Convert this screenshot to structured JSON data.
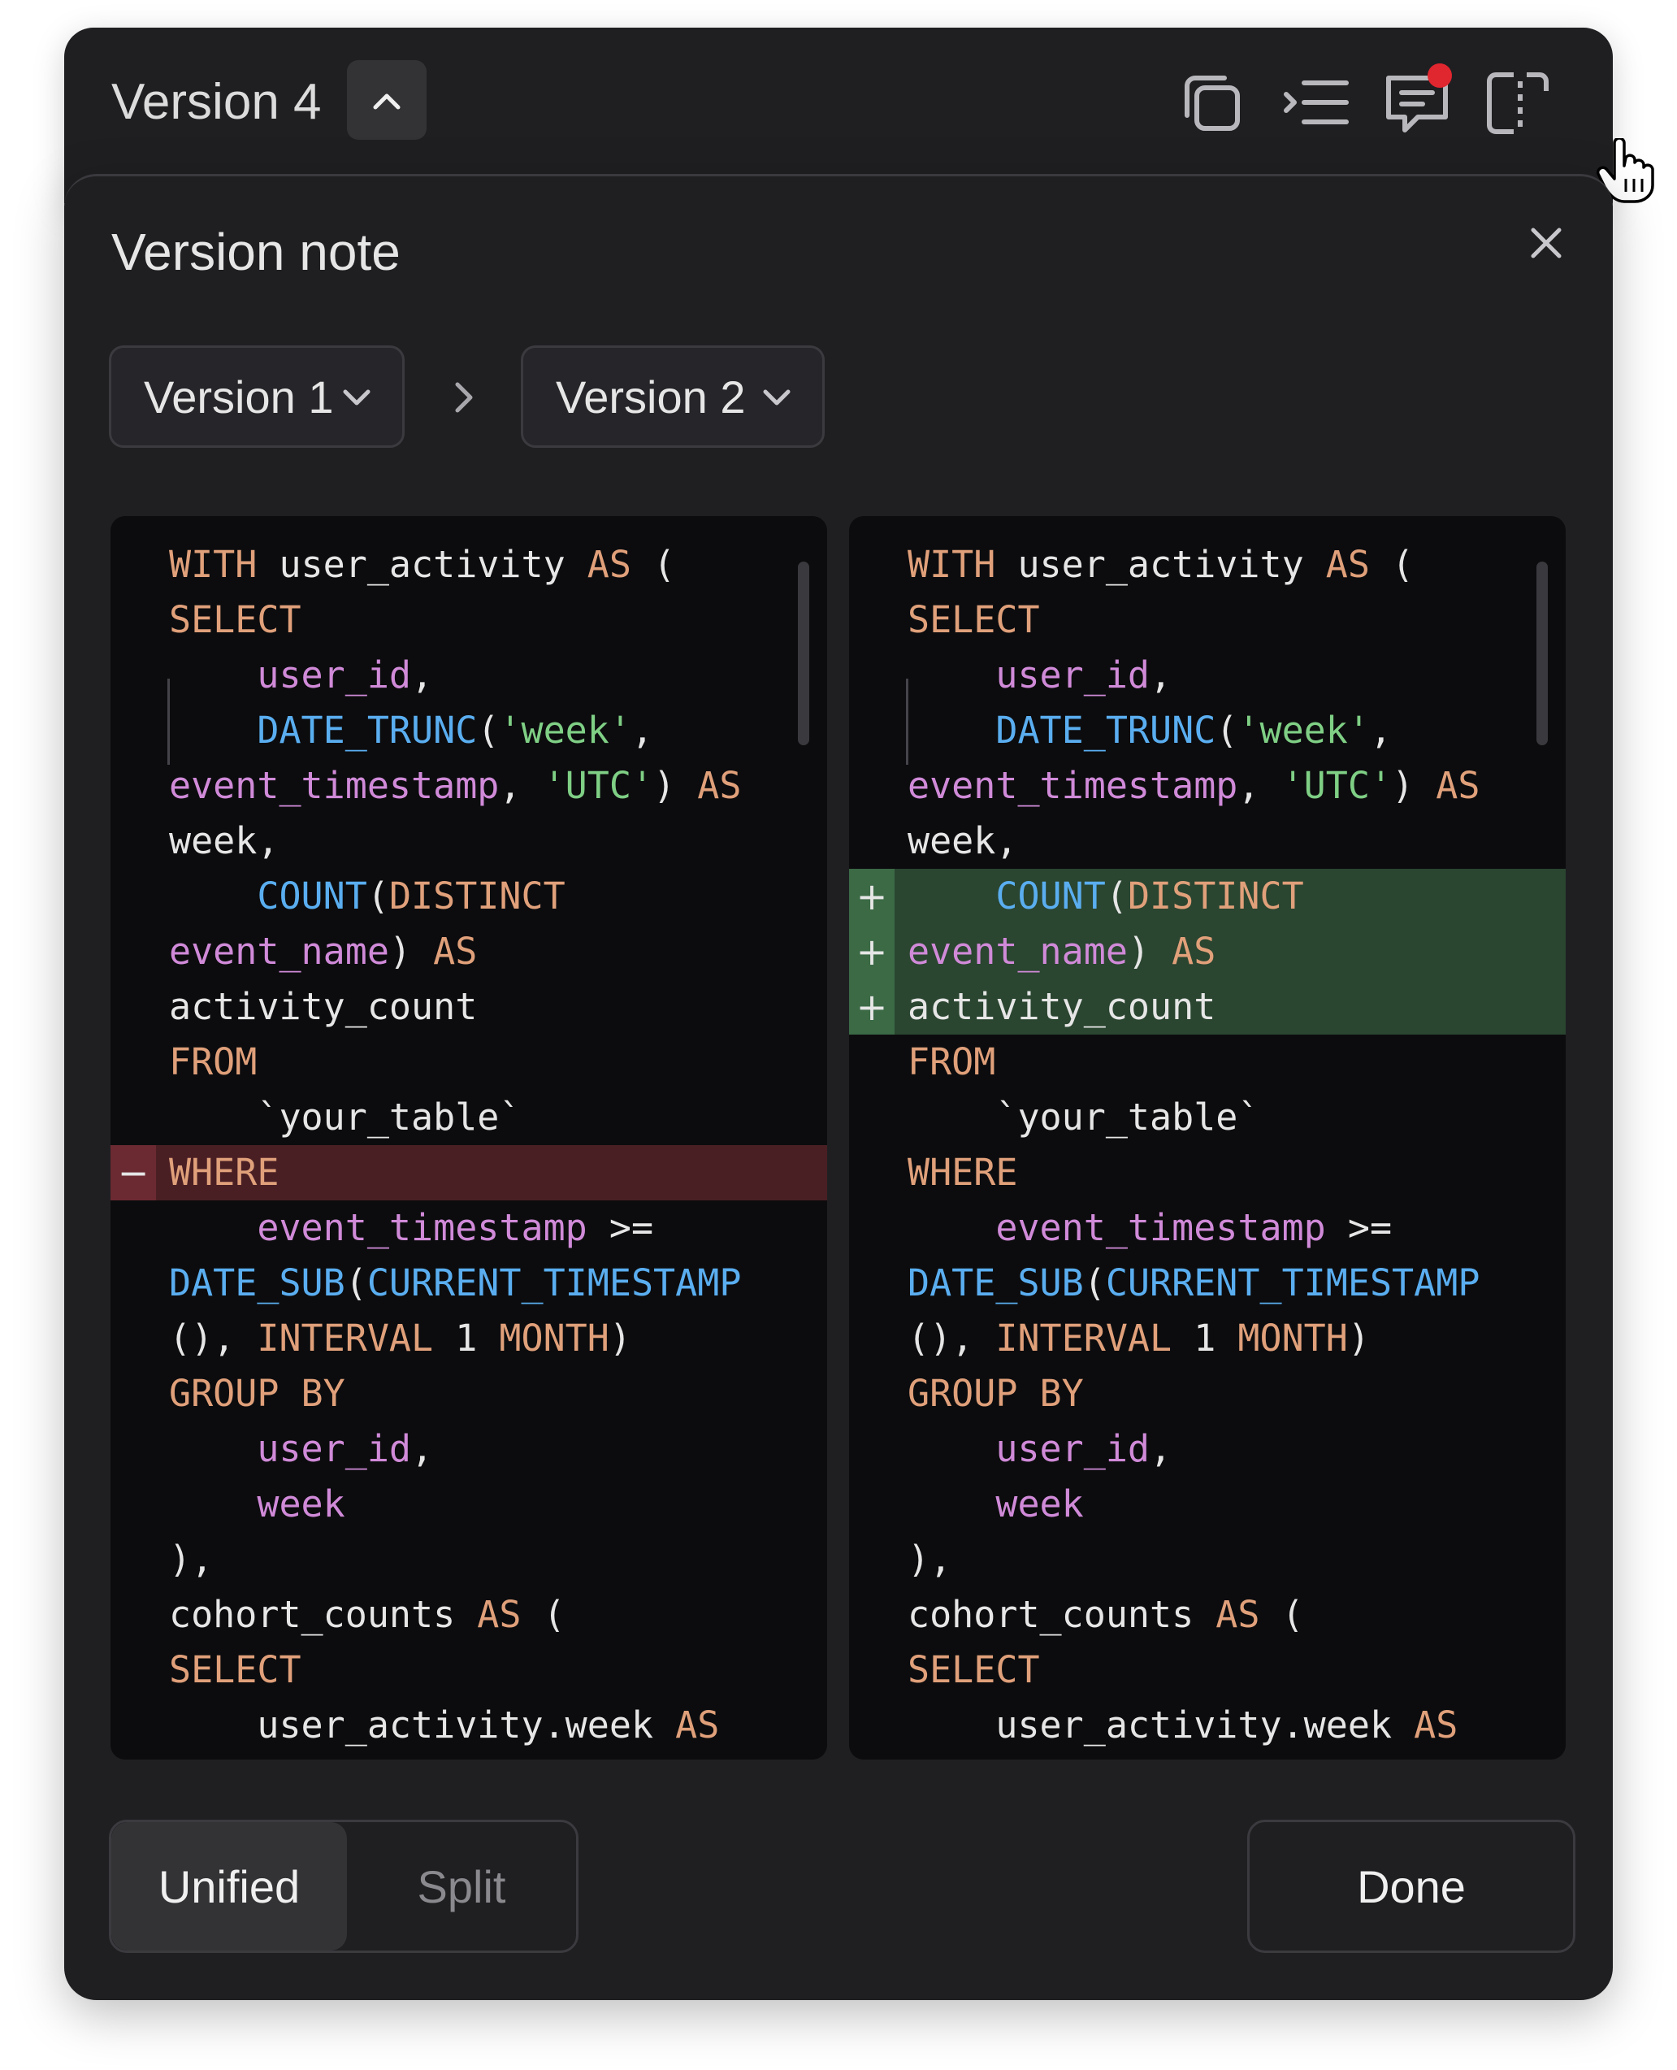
{
  "header": {
    "title": "Version 4",
    "toolbar_icons": [
      "copy-icon",
      "outline-icon",
      "comment-icon",
      "select-icon"
    ],
    "has_notification": true
  },
  "dialog": {
    "title": "Version note",
    "from_version": "Version 1",
    "to_version": "Version 2",
    "view_modes": [
      "Unified",
      "Split"
    ],
    "selected_view_mode": "Unified",
    "done_label": "Done"
  },
  "colors": {
    "keyword": "#e0a07a",
    "function": "#5aaef0",
    "identifier": "#d08ad8",
    "string": "#7fcf85",
    "added_bg": "#2a4530",
    "removed_bg": "#4a1f24",
    "notification": "#e0262f"
  },
  "left_code": [
    {
      "diff": "",
      "tokens": [
        [
          "kw",
          "WITH"
        ],
        [
          "pl",
          " user_activity "
        ],
        [
          "kw",
          "AS"
        ],
        [
          "pl",
          " ("
        ]
      ]
    },
    {
      "diff": "",
      "tokens": [
        [
          "kw",
          "SELECT"
        ]
      ]
    },
    {
      "diff": "",
      "tokens": [
        [
          "pl",
          "    "
        ],
        [
          "id",
          "user_id"
        ],
        [
          "pl",
          ","
        ]
      ]
    },
    {
      "diff": "",
      "tokens": [
        [
          "pl",
          "    "
        ],
        [
          "fn",
          "DATE_TRUNC"
        ],
        [
          "pl",
          "("
        ],
        [
          "str",
          "'week'"
        ],
        [
          "pl",
          ","
        ]
      ]
    },
    {
      "diff": "",
      "tokens": [
        [
          "id",
          "event_timestamp"
        ],
        [
          "pl",
          ", "
        ],
        [
          "str",
          "'UTC'"
        ],
        [
          "pl",
          ") "
        ],
        [
          "kw",
          "AS"
        ]
      ]
    },
    {
      "diff": "",
      "tokens": [
        [
          "pl",
          "week,"
        ]
      ]
    },
    {
      "diff": "",
      "tokens": [
        [
          "pl",
          "    "
        ],
        [
          "fn",
          "COUNT"
        ],
        [
          "pl",
          "("
        ],
        [
          "kw",
          "DISTINCT"
        ]
      ]
    },
    {
      "diff": "",
      "tokens": [
        [
          "id",
          "event_name"
        ],
        [
          "pl",
          ") "
        ],
        [
          "kw",
          "AS"
        ]
      ]
    },
    {
      "diff": "",
      "tokens": [
        [
          "pl",
          "activity_count"
        ]
      ]
    },
    {
      "diff": "",
      "tokens": [
        [
          "kw",
          "FROM"
        ]
      ]
    },
    {
      "diff": "",
      "tokens": [
        [
          "pl",
          "    `your_table`"
        ]
      ]
    },
    {
      "diff": "removed",
      "mark": "−",
      "tokens": [
        [
          "kw",
          "WHERE"
        ]
      ]
    },
    {
      "diff": "",
      "tokens": [
        [
          "pl",
          "    "
        ],
        [
          "id",
          "event_timestamp"
        ],
        [
          "pl",
          " >="
        ]
      ]
    },
    {
      "diff": "",
      "tokens": [
        [
          "fn",
          "DATE_SUB"
        ],
        [
          "pl",
          "("
        ],
        [
          "fn",
          "CURRENT_TIMESTAMP"
        ]
      ]
    },
    {
      "diff": "",
      "tokens": [
        [
          "pl",
          "(), "
        ],
        [
          "kw",
          "INTERVAL"
        ],
        [
          "pl",
          " 1 "
        ],
        [
          "kw",
          "MONTH"
        ],
        [
          "pl",
          ")"
        ]
      ]
    },
    {
      "diff": "",
      "tokens": [
        [
          "kw",
          "GROUP BY"
        ]
      ]
    },
    {
      "diff": "",
      "tokens": [
        [
          "pl",
          "    "
        ],
        [
          "id",
          "user_id"
        ],
        [
          "pl",
          ","
        ]
      ]
    },
    {
      "diff": "",
      "tokens": [
        [
          "pl",
          "    "
        ],
        [
          "id",
          "week"
        ]
      ]
    },
    {
      "diff": "",
      "tokens": [
        [
          "pl",
          "),"
        ]
      ]
    },
    {
      "diff": "",
      "tokens": [
        [
          "pl",
          "cohort_counts "
        ],
        [
          "kw",
          "AS"
        ],
        [
          "pl",
          " ("
        ]
      ]
    },
    {
      "diff": "",
      "tokens": [
        [
          "kw",
          "SELECT"
        ]
      ]
    },
    {
      "diff": "",
      "tokens": [
        [
          "pl",
          "    user_activity.week "
        ],
        [
          "kw",
          "AS"
        ]
      ]
    }
  ],
  "right_code": [
    {
      "diff": "",
      "tokens": [
        [
          "kw",
          "WITH"
        ],
        [
          "pl",
          " user_activity "
        ],
        [
          "kw",
          "AS"
        ],
        [
          "pl",
          " ("
        ]
      ]
    },
    {
      "diff": "",
      "tokens": [
        [
          "kw",
          "SELECT"
        ]
      ]
    },
    {
      "diff": "",
      "tokens": [
        [
          "pl",
          "    "
        ],
        [
          "id",
          "user_id"
        ],
        [
          "pl",
          ","
        ]
      ]
    },
    {
      "diff": "",
      "tokens": [
        [
          "pl",
          "    "
        ],
        [
          "fn",
          "DATE_TRUNC"
        ],
        [
          "pl",
          "("
        ],
        [
          "str",
          "'week'"
        ],
        [
          "pl",
          ","
        ]
      ]
    },
    {
      "diff": "",
      "tokens": [
        [
          "id",
          "event_timestamp"
        ],
        [
          "pl",
          ", "
        ],
        [
          "str",
          "'UTC'"
        ],
        [
          "pl",
          ") "
        ],
        [
          "kw",
          "AS"
        ]
      ]
    },
    {
      "diff": "",
      "tokens": [
        [
          "pl",
          "week,"
        ]
      ]
    },
    {
      "diff": "added",
      "mark": "+",
      "tokens": [
        [
          "pl",
          "    "
        ],
        [
          "fn",
          "COUNT"
        ],
        [
          "pl",
          "("
        ],
        [
          "kw",
          "DISTINCT"
        ]
      ]
    },
    {
      "diff": "added",
      "mark": "+",
      "tokens": [
        [
          "id",
          "event_name"
        ],
        [
          "pl",
          ") "
        ],
        [
          "kw",
          "AS"
        ]
      ]
    },
    {
      "diff": "added",
      "mark": "+",
      "tokens": [
        [
          "pl",
          "activity_count"
        ]
      ]
    },
    {
      "diff": "",
      "tokens": [
        [
          "kw",
          "FROM"
        ]
      ]
    },
    {
      "diff": "",
      "tokens": [
        [
          "pl",
          "    `your_table`"
        ]
      ]
    },
    {
      "diff": "",
      "tokens": [
        [
          "kw",
          "WHERE"
        ]
      ]
    },
    {
      "diff": "",
      "tokens": [
        [
          "pl",
          "    "
        ],
        [
          "id",
          "event_timestamp"
        ],
        [
          "pl",
          " >="
        ]
      ]
    },
    {
      "diff": "",
      "tokens": [
        [
          "fn",
          "DATE_SUB"
        ],
        [
          "pl",
          "("
        ],
        [
          "fn",
          "CURRENT_TIMESTAMP"
        ]
      ]
    },
    {
      "diff": "",
      "tokens": [
        [
          "pl",
          "(), "
        ],
        [
          "kw",
          "INTERVAL"
        ],
        [
          "pl",
          " 1 "
        ],
        [
          "kw",
          "MONTH"
        ],
        [
          "pl",
          ")"
        ]
      ]
    },
    {
      "diff": "",
      "tokens": [
        [
          "kw",
          "GROUP BY"
        ]
      ]
    },
    {
      "diff": "",
      "tokens": [
        [
          "pl",
          "    "
        ],
        [
          "id",
          "user_id"
        ],
        [
          "pl",
          ","
        ]
      ]
    },
    {
      "diff": "",
      "tokens": [
        [
          "pl",
          "    "
        ],
        [
          "id",
          "week"
        ]
      ]
    },
    {
      "diff": "",
      "tokens": [
        [
          "pl",
          "),"
        ]
      ]
    },
    {
      "diff": "",
      "tokens": [
        [
          "pl",
          "cohort_counts "
        ],
        [
          "kw",
          "AS"
        ],
        [
          "pl",
          " ("
        ]
      ]
    },
    {
      "diff": "",
      "tokens": [
        [
          "kw",
          "SELECT"
        ]
      ]
    },
    {
      "diff": "",
      "tokens": [
        [
          "pl",
          "    user_activity.week "
        ],
        [
          "kw",
          "AS"
        ]
      ]
    }
  ]
}
